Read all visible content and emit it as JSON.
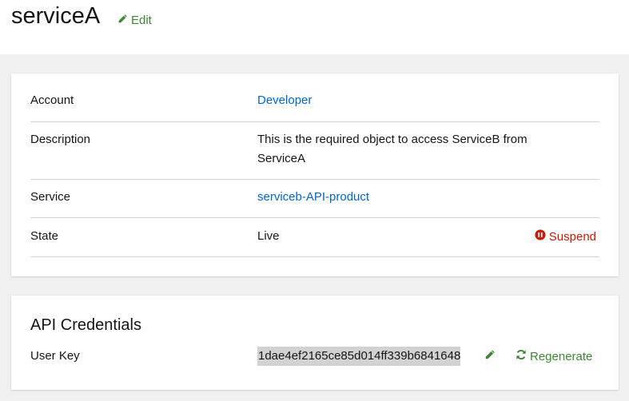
{
  "page": {
    "title": "serviceA",
    "edit_label": "Edit"
  },
  "details": {
    "account_label": "Account",
    "account_value": "Developer",
    "description_label": "Description",
    "description_value": "This is the required object to access ServiceB from ServiceA",
    "service_label": "Service",
    "service_value": "serviceb-API-product",
    "state_label": "State",
    "state_value": "Live",
    "suspend_label": "Suspend"
  },
  "credentials": {
    "title": "API Credentials",
    "user_key_label": "User Key",
    "user_key_value": "1dae4ef2165ce85d014ff339b6841648",
    "regenerate_label": "Regenerate"
  },
  "colors": {
    "link": "#0066cc",
    "success": "#3e8635",
    "danger": "#c9190b"
  }
}
